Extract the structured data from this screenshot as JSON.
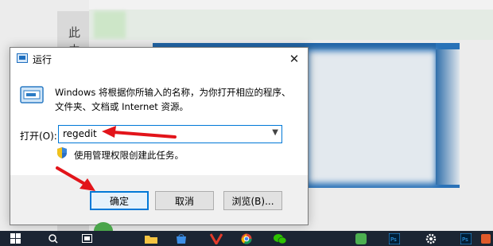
{
  "background": {
    "side_text": "此 由"
  },
  "dialog": {
    "title": "运行",
    "close_label": "✕",
    "description": "Windows 将根据你所输入的名称，为你打开相应的程序、文件夹、文档或 Internet 资源。",
    "open_label": "打开(O):",
    "input_value": "regedit",
    "admin_note": "使用管理权限创建此任务。",
    "buttons": {
      "ok": "确定",
      "cancel": "取消",
      "browse": "浏览(B)..."
    }
  },
  "taskbar": {
    "items": [
      "start",
      "search",
      "task-view",
      "file-explorer",
      "store",
      "app-red",
      "chrome",
      "wechat",
      "app-green",
      "photoshop",
      "photoshop-2",
      "settings",
      "app-last"
    ]
  },
  "colors": {
    "accent": "#0078d7",
    "arrow": "#e2141a",
    "taskbar": "#1b2533"
  }
}
